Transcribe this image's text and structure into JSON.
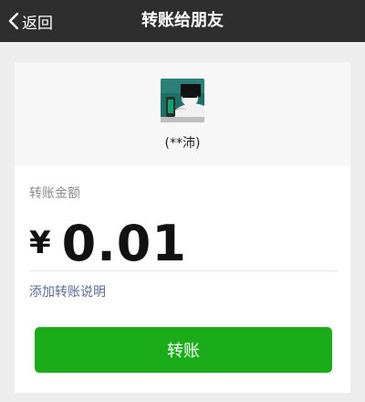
{
  "nav": {
    "back_label": "返回",
    "title": "转账给朋友"
  },
  "payee": {
    "name": "(**沛)"
  },
  "amount": {
    "label": "转账金额",
    "currency_symbol": "¥",
    "value": "0.01"
  },
  "note": {
    "link_label": "添加转账说明"
  },
  "actions": {
    "transfer_label": "转账"
  },
  "colors": {
    "nav_background": "#2e2e2e",
    "primary_button": "#1aad19",
    "link": "#576b95",
    "avatar_background": "#1e6f6a"
  }
}
